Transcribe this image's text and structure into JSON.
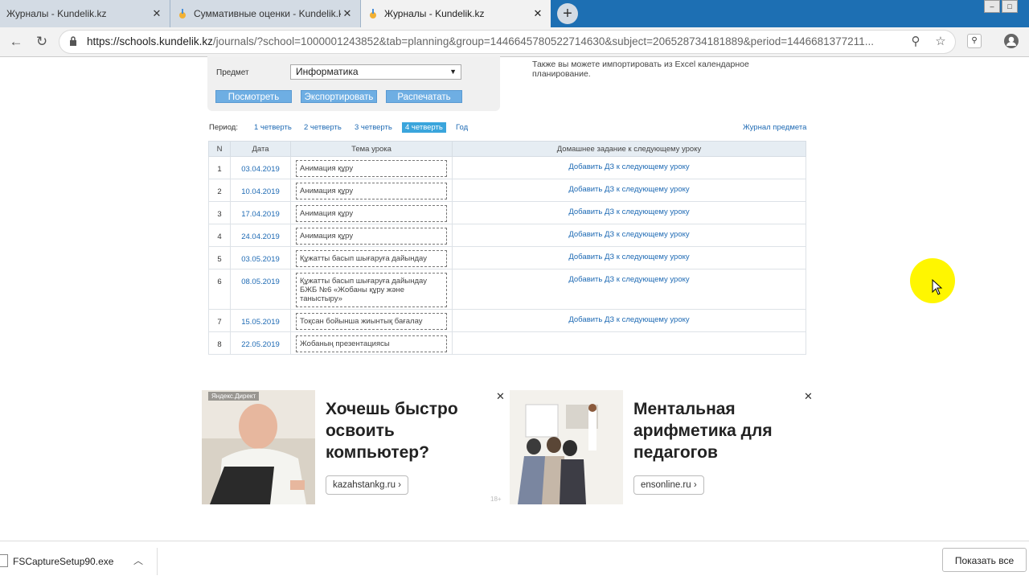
{
  "browser": {
    "tabs": [
      {
        "title": "Журналы - Kundelik.kz",
        "active": false
      },
      {
        "title": "Суммативные оценки - Kundelik.kz",
        "active": false
      },
      {
        "title": "Журналы - Kundelik.kz",
        "active": true
      }
    ],
    "new_tab": "+",
    "url_main": "https://schools.kundelik.kz",
    "url_rest": "/journals/?school=1000001243852&tab=planning&group=1446645780522714630&subject=2065287341818​89&period=1446681377211..."
  },
  "filter": {
    "subject_label": "Предмет",
    "subject_value": "Информатика",
    "buttons": {
      "view": "Посмотреть",
      "export": "Экспортировать",
      "print": "Распечатать"
    }
  },
  "import_note": "Также вы можете импортировать из Excel календарное планирование.",
  "period": {
    "label": "Период:",
    "options": [
      "1 четверть",
      "2 четверть",
      "3 четверть",
      "4 четверть",
      "Год"
    ],
    "selected": "4 четверть",
    "journal_link": "Журнал предмета"
  },
  "table": {
    "headers": [
      "N",
      "Дата",
      "Тема урока",
      "Домашнее задание к следующему уроку"
    ],
    "rows": [
      {
        "n": "1",
        "date": "03.04.2019",
        "topic": "Анимация құру",
        "hw": "Добавить ДЗ к следующему уроку"
      },
      {
        "n": "2",
        "date": "10.04.2019",
        "topic": "Анимация құру",
        "hw": "Добавить ДЗ к следующему уроку"
      },
      {
        "n": "3",
        "date": "17.04.2019",
        "topic": "Анимация құру",
        "hw": "Добавить ДЗ к следующему уроку"
      },
      {
        "n": "4",
        "date": "24.04.2019",
        "topic": "Анимация құру",
        "hw": "Добавить ДЗ к следующему уроку"
      },
      {
        "n": "5",
        "date": "03.05.2019",
        "topic": "Құжатты басып шығаруға дайындау",
        "hw": "Добавить ДЗ к следующему уроку"
      },
      {
        "n": "6",
        "date": "08.05.2019",
        "topic": "Құжатты басып шығаруға дайындау БЖБ №6 «Жобаны құру және таныстыру»",
        "hw": "Добавить ДЗ к следующему уроку"
      },
      {
        "n": "7",
        "date": "15.05.2019",
        "topic": "Тоқсан бойынша жиынтық бағалау",
        "hw": "Добавить ДЗ к следующему уроку"
      },
      {
        "n": "8",
        "date": "22.05.2019",
        "topic": "Жобаның презентациясы",
        "hw": ""
      }
    ]
  },
  "ads": [
    {
      "label": "Яндекс.Директ",
      "headline": "Хочешь быстро освоить компьютер?",
      "domain": "kazahstankg.ru ›"
    },
    {
      "label": "",
      "headline": "Ментальная арифметика для педагогов",
      "domain": "ensonline.ru ›"
    }
  ],
  "age_mark": "18+",
  "downloads": {
    "file": "FSCaptureSetup90.exe",
    "show_all": "Показать все"
  },
  "colors": {
    "tabstrip": "#1d6fb3",
    "link": "#1e6ab4",
    "button": "#6eaee3",
    "active_period": "#3aa5dc",
    "highlight": "#fff600"
  }
}
